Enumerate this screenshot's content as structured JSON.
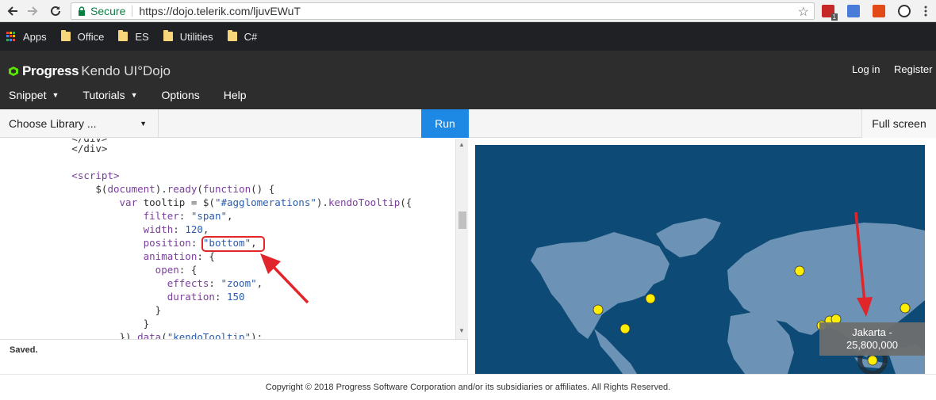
{
  "browser": {
    "secure_label": "Secure",
    "url": "https://dojo.telerik.com/ljuvEWuT",
    "extension_badge": "1"
  },
  "bookmarks": [
    {
      "label": "Apps"
    },
    {
      "label": "Office"
    },
    {
      "label": "ES"
    },
    {
      "label": "Utilities"
    },
    {
      "label": "C#"
    }
  ],
  "header": {
    "brand_bold": "Progress",
    "brand_rest": "Kendo UI°Dojo",
    "login": "Log in",
    "register": "Register",
    "menu": [
      {
        "label": "Snippet",
        "has_caret": true
      },
      {
        "label": "Tutorials",
        "has_caret": true
      },
      {
        "label": "Options",
        "has_caret": false
      },
      {
        "label": "Help",
        "has_caret": false
      }
    ]
  },
  "toolbar": {
    "library_select": "Choose Library ...",
    "run": "Run",
    "fullscreen": "Full screen"
  },
  "editor": {
    "status": "Saved."
  },
  "preview": {
    "tooltip_line1": "Jakarta -",
    "tooltip_line2": "25,800,000"
  },
  "footer": {
    "copyright": "Copyright © 2018 Progress Software Corporation and/or its subsidiaries or affiliates. All Rights Reserved."
  },
  "colors": {
    "run_button": "#1e88e5",
    "header_bg": "#2d2d2d",
    "map_ocean": "#0d4a76",
    "map_land": "#6c93b5",
    "marker": "#ffee00",
    "annotation": "#e0262b"
  }
}
